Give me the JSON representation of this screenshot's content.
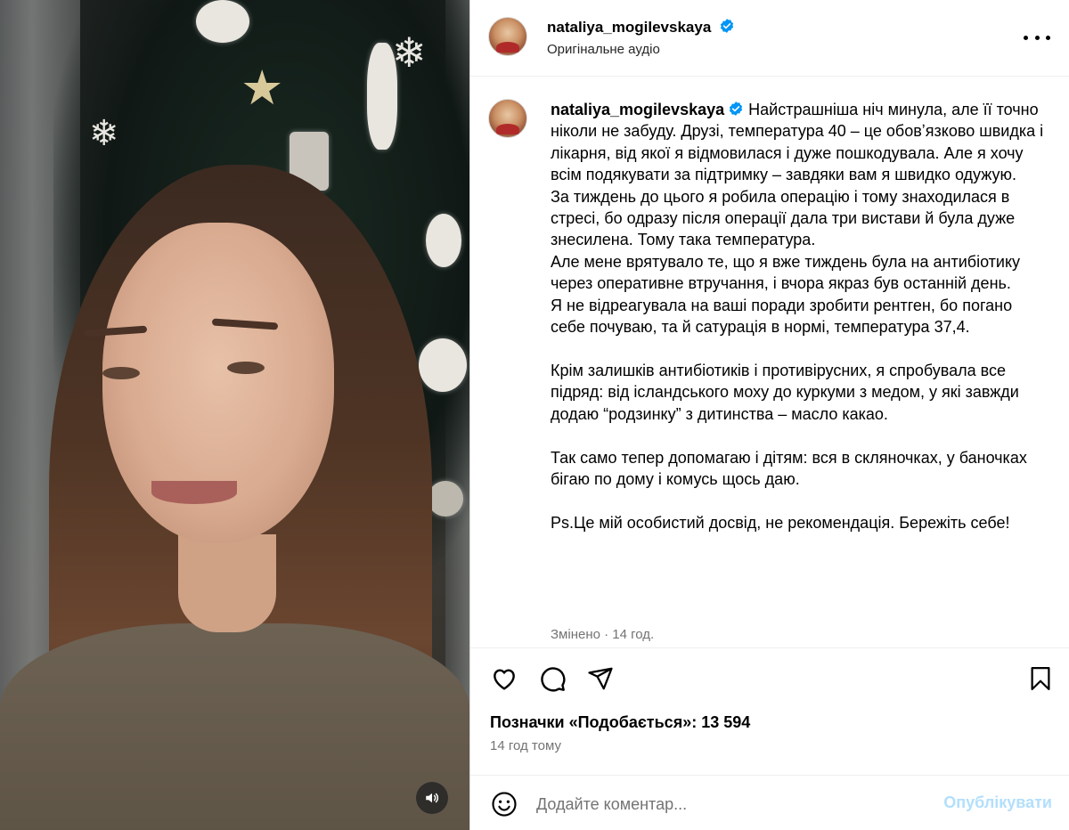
{
  "post": {
    "username": "nataliya_mogilevskaya",
    "audio_label": "Оригінальне аудіо",
    "caption": "Найстрашніша ніч минула, але її точно ніколи не забуду. Друзі, температура 40 – це обовʼязково швидка і лікарня, від якої я відмовилася і дуже пошкодувала. Але я хочу всім подякувати за підтримку – завдяки вам я швидко одужую.\nЗа тиждень до цього я робила операцію і тому знаходилася в стресі, бо одразу після операції дала три вистави й була дуже знесилена. Тому така температура.\nАле мене врятувало те, що я вже тиждень була на антибіотику через оперативне втручання, і вчора якраз був останній день.\nЯ не відреагувала на ваші поради зробити рентген, бо погано себе почуваю, та й сатурація в нормі, температура 37,4.\n\nКрім залишків антибіотиків і противірусних, я спробувала все підряд: від ісландського моху до куркуми з медом, у які завжди додаю “родзинку” з дитинства – масло какао.\n\nТак само тепер допомагаю і дітям: вся в скляночках, у баночках бігаю по дому і комусь щось даю.\n\nPs.Це мій особистий досвід, не рекомендація. Бережіть себе!",
    "edited_label": "Змінено · 14 год.",
    "likes_text": "Позначки «Подобається»: 13 594",
    "time_ago": "14 год тому"
  },
  "comment_box": {
    "placeholder": "Додайте коментар...",
    "publish_label": "Опублікувати"
  },
  "colors": {
    "verified_blue": "#0095f6",
    "publish_disabled": "#b2dffc",
    "secondary_text": "#737373"
  },
  "icons": [
    "verified-icon",
    "more-icon",
    "heart-icon",
    "comment-icon",
    "share-icon",
    "bookmark-icon",
    "emoji-icon",
    "sound-icon"
  ]
}
